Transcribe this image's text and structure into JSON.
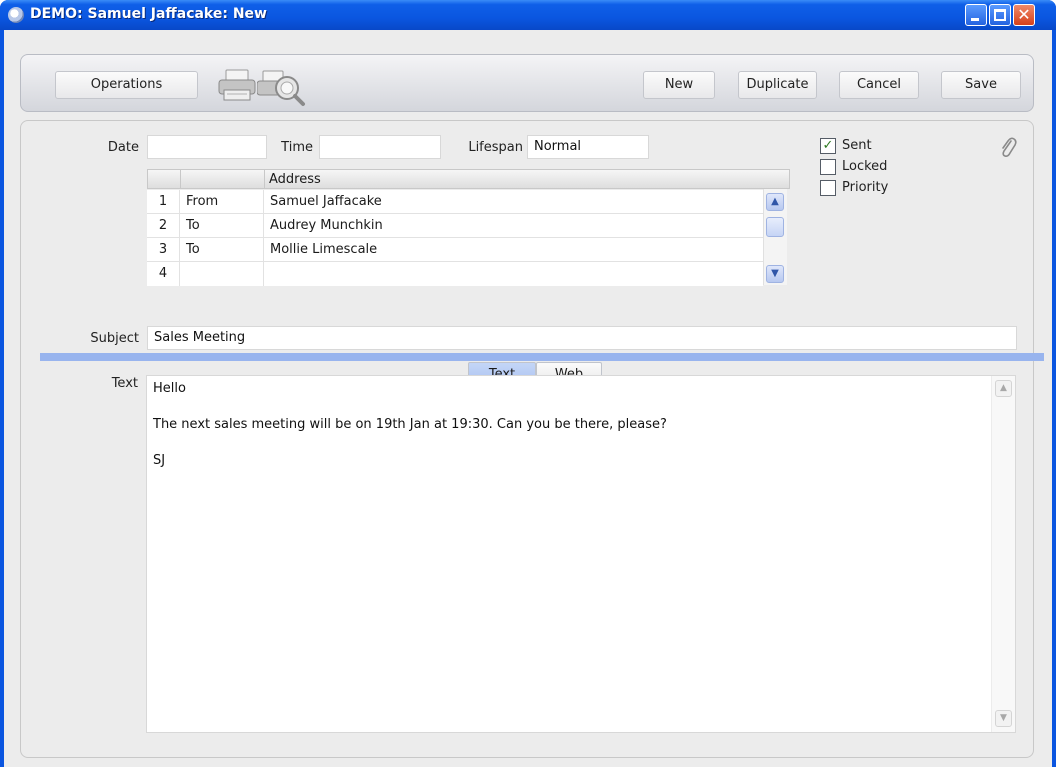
{
  "window": {
    "title": "DEMO: Samuel Jaffacake: New",
    "close_glyph": "✕"
  },
  "toolbar": {
    "operations_label": "Operations",
    "new_label": "New",
    "duplicate_label": "Duplicate",
    "cancel_label": "Cancel",
    "save_label": "Save",
    "icons": [
      "printer-icon",
      "print-preview-icon"
    ]
  },
  "form": {
    "date_label": "Date",
    "date_value": "",
    "time_label": "Time",
    "time_value": "",
    "lifespan_label": "Lifespan",
    "lifespan_value": "Normal",
    "checkboxes": {
      "sent": {
        "label": "Sent",
        "checked": true,
        "mark": "✓"
      },
      "locked": {
        "label": "Locked",
        "checked": false
      },
      "priority": {
        "label": "Priority",
        "checked": false
      }
    },
    "address_table": {
      "columns": [
        "",
        "",
        "Address"
      ],
      "rows": [
        {
          "num": "1",
          "type": "From",
          "address": "Samuel Jaffacake"
        },
        {
          "num": "2",
          "type": "To",
          "address": "Audrey Munchkin"
        },
        {
          "num": "3",
          "type": "To",
          "address": "Mollie Limescale"
        },
        {
          "num": "4",
          "type": "",
          "address": ""
        }
      ]
    },
    "subject_label": "Subject",
    "subject_value": "Sales Meeting",
    "tabs": [
      {
        "label": "Text",
        "active": true
      },
      {
        "label": "Web",
        "active": false
      }
    ],
    "text_label": "Text",
    "text_lines": [
      "Hello",
      "The next sales meeting will be on 19th Jan at 19:30. Can you be there, please?",
      "SJ"
    ]
  },
  "colors": {
    "title_bar": "#0a56e0",
    "tab_active": "#a7bff0",
    "tab_underline": "#98b4ee",
    "check_mark": "#2f7a22"
  }
}
